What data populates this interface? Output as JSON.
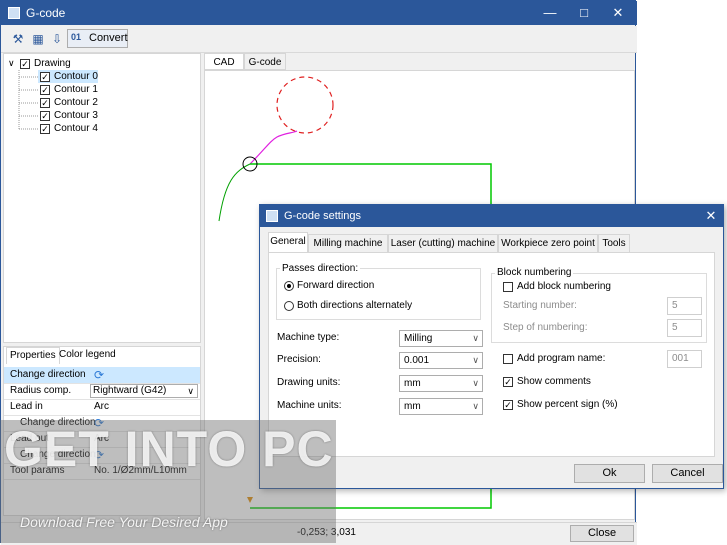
{
  "window": {
    "title": "G-code"
  },
  "toolbar": {
    "convert_label": "Convert",
    "convert_icon_text": "01"
  },
  "tree": {
    "root_label": "Drawing",
    "items": [
      "Contour 0",
      "Contour 1",
      "Contour 2",
      "Contour 3",
      "Contour 4"
    ]
  },
  "props": {
    "tabs": [
      "Properties",
      "Color legend"
    ],
    "rows": {
      "change_direction": "Change direction",
      "radius_comp": "Radius comp.",
      "radius_comp_value": "Rightward (G42)",
      "lead_in": "Lead in",
      "lead_in_value": "Arc",
      "lead_in_change": "Change direction",
      "lead_out": "Lead out",
      "lead_out_value": "Arc",
      "lead_out_change": "Change direction",
      "tool_params": "Tool params",
      "tool_params_value": "No. 1/Ø2mm/L10mm"
    }
  },
  "cad_tabs": [
    "CAD",
    "G-code"
  ],
  "status": {
    "coords": "-0,253; 3,031",
    "close_label": "Close"
  },
  "dialog": {
    "title": "G-code settings",
    "tabs": [
      "General",
      "Milling machine",
      "Laser (cutting) machine",
      "Workpiece zero point",
      "Tools"
    ],
    "passes_direction": {
      "label": "Passes direction:",
      "forward": "Forward direction",
      "both": "Both directions alternately"
    },
    "fields": {
      "machine_type_label": "Machine type:",
      "machine_type_value": "Milling",
      "precision_label": "Precision:",
      "precision_value": "0.001",
      "drawing_units_label": "Drawing units:",
      "drawing_units_value": "mm",
      "machine_units_label": "Machine units:",
      "machine_units_value": "mm"
    },
    "block_numbering": {
      "label": "Block numbering",
      "add_label": "Add block numbering",
      "starting_label": "Starting number:",
      "starting_value": "5",
      "step_label": "Step of numbering:",
      "step_value": "5"
    },
    "options": {
      "add_program_name": "Add program name:",
      "program_name_value": "001",
      "show_comments": "Show comments",
      "show_percent": "Show percent sign (%)"
    },
    "ok_label": "Ok",
    "cancel_label": "Cancel"
  },
  "watermark": {
    "title": "GET INTO PC",
    "subtitle": "Download Free Your Desired App"
  },
  "colors": {
    "accent": "#2b579a",
    "selection": "#cce8ff",
    "contour": "#00c800",
    "circle": "#e02020",
    "lead": "#e020e0"
  }
}
